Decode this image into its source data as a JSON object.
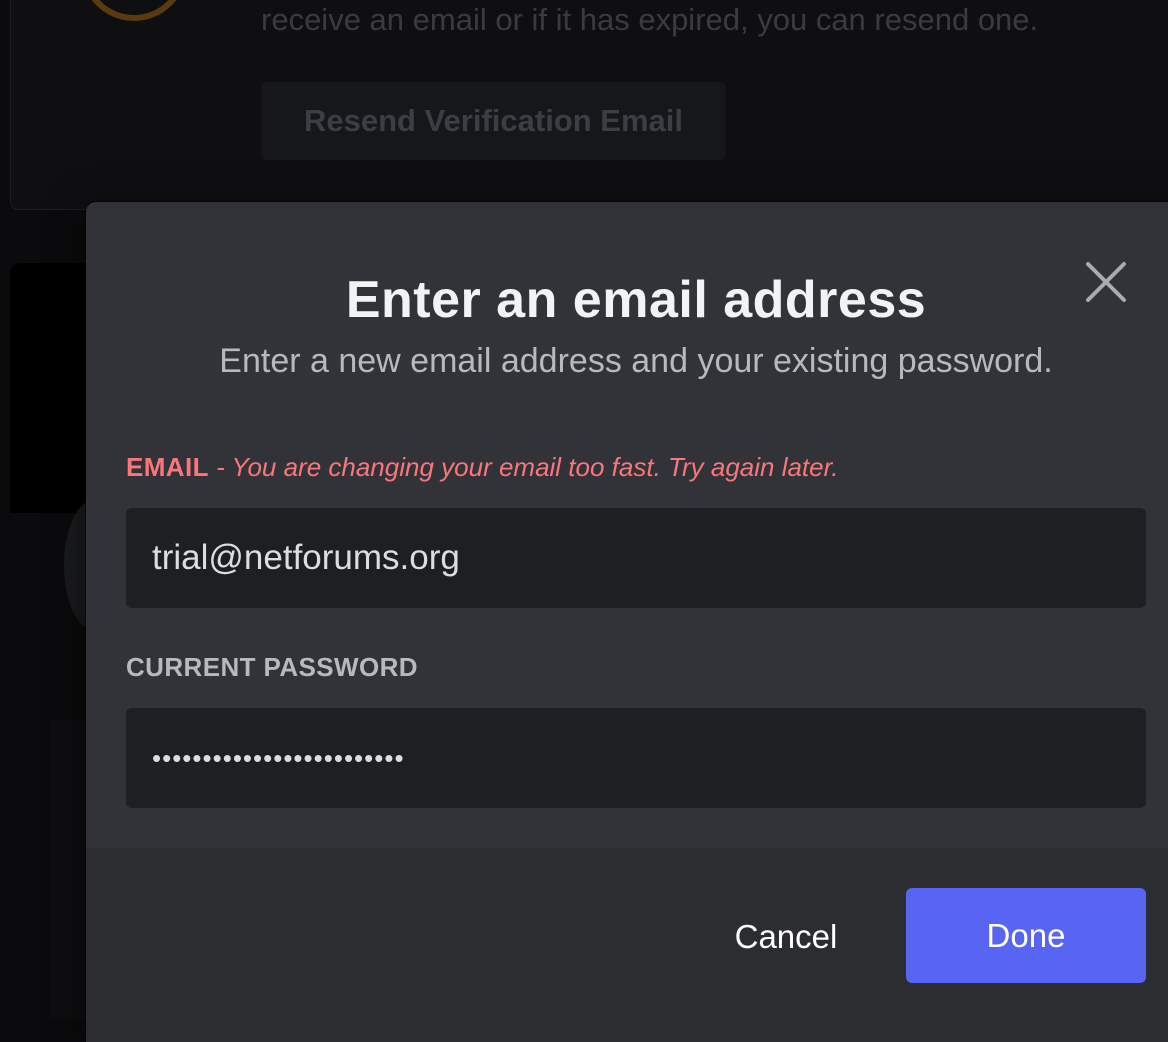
{
  "background": {
    "verification_text": "receive an email or if it has expired, you can resend one.",
    "resend_button_label": "Resend Verification Email"
  },
  "modal": {
    "title": "Enter an email address",
    "subtitle": "Enter a new email address and your existing password.",
    "close_icon": "close-icon",
    "email": {
      "label": "EMAIL",
      "separator": " - ",
      "error": "You are changing your email too fast. Try again later.",
      "value": "trial@netforums.org"
    },
    "password": {
      "label": "CURRENT PASSWORD",
      "masked_value": "•••••••••••••••••••••••••"
    },
    "footer": {
      "cancel_label": "Cancel",
      "done_label": "Done"
    }
  },
  "colors": {
    "accent": "#5865f2",
    "error": "#f8777c",
    "modal_bg": "#313338",
    "footer_bg": "#2b2d31",
    "input_bg": "#1e1f22"
  }
}
